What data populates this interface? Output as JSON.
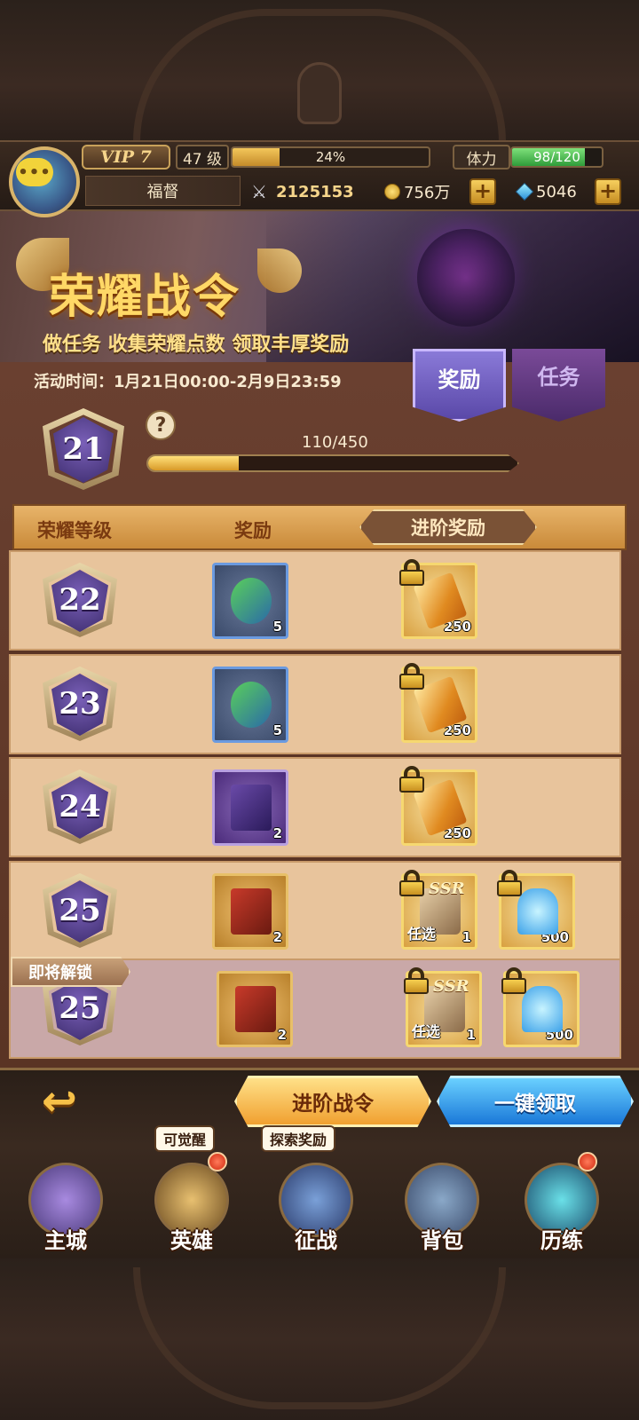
{
  "header": {
    "vip_label": "VIP 7",
    "level_label": "47 级",
    "exp_text": "24%",
    "exp_fraction": 0.24,
    "stamina_label": "体力",
    "stamina_text": "98/120",
    "stamina_fraction": 0.8167,
    "player_name": "福督",
    "combat_power": "2125153",
    "gold": "756万",
    "gems": "5046"
  },
  "banner": {
    "title": "荣耀战令",
    "subtitle": "做任务 收集荣耀点数 领取丰厚奖励"
  },
  "event": {
    "time_text": "活动时间：1月21日00:00-2月9日23:59",
    "current_rank": "21",
    "progress_text": "110/450",
    "progress_fraction": 0.2444,
    "help_symbol": "?"
  },
  "tabs": [
    {
      "label": "奖励",
      "active": true
    },
    {
      "label": "任务",
      "active": false
    }
  ],
  "table": {
    "col_level": "荣耀等级",
    "col_reward": "奖励",
    "col_advanced": "进阶奖励"
  },
  "rows": [
    {
      "rank": "22",
      "free_qty": "5",
      "adv": [
        {
          "qty": "250",
          "ssr": false
        }
      ]
    },
    {
      "rank": "23",
      "free_qty": "5",
      "adv": [
        {
          "qty": "250",
          "ssr": false
        }
      ]
    },
    {
      "rank": "24",
      "free_qty": "2",
      "adv": [
        {
          "qty": "250",
          "ssr": false
        }
      ]
    },
    {
      "rank": "25",
      "free_qty": "2",
      "adv": [
        {
          "qty": "1",
          "ssr": true,
          "ssr_label": "SSR",
          "pick_label": "任选"
        },
        {
          "qty": "500",
          "ssr": false
        }
      ]
    },
    {
      "rank": "25",
      "free_qty": "2",
      "adv": [
        {
          "qty": "1",
          "ssr": true,
          "ssr_label": "SSR",
          "pick_label": "任选"
        },
        {
          "qty": "500",
          "ssr": false
        }
      ]
    }
  ],
  "unlock_label": "即将解锁",
  "actions": {
    "advance_label": "进阶战令",
    "claim_all_label": "一键领取"
  },
  "nav": [
    {
      "label": "主城",
      "icon": "castle-icon"
    },
    {
      "label": "英雄",
      "icon": "hero-icon",
      "tag": "可觉醒",
      "red_dot": true
    },
    {
      "label": "征战",
      "icon": "battle-icon",
      "tag": "探索奖励"
    },
    {
      "label": "背包",
      "icon": "backpack-icon"
    },
    {
      "label": "历练",
      "icon": "portal-icon",
      "red_dot": true
    }
  ]
}
